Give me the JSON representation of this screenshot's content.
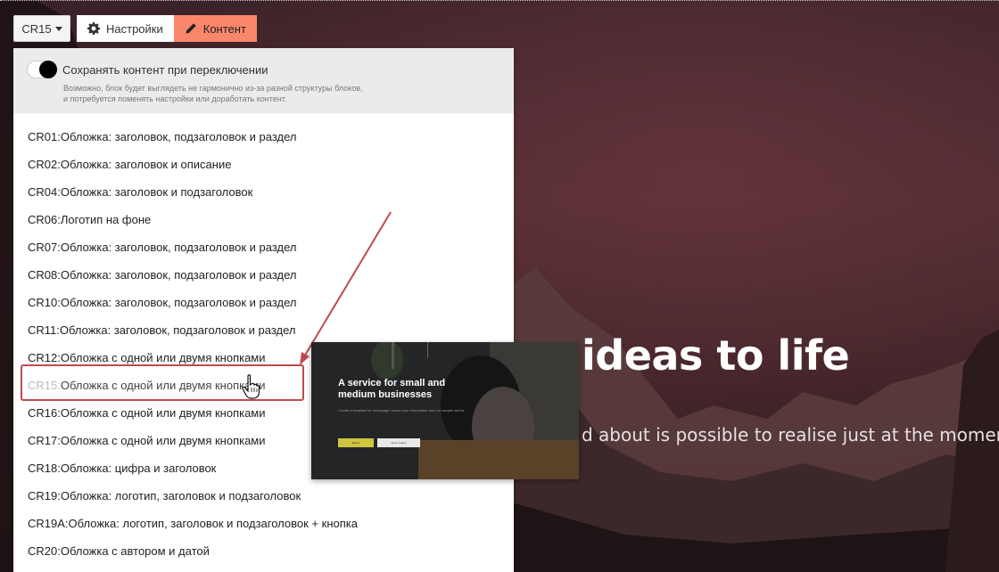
{
  "toolbar": {
    "block_code": "CR15",
    "settings_label": "Настройки",
    "content_label": "Контент",
    "active_tab": "content",
    "accent_color": "#fa876b"
  },
  "panel": {
    "keep_content_label": "Сохранять контент при переключении",
    "keep_content_on": true,
    "keep_content_note": "Возможно, блок будет выглядеть не гармонично из-за разной структуры блоков, и потребуется поменять настройки или доработать контент.",
    "items": [
      {
        "code": "CR01",
        "label": "Обложка: заголовок, подзаголовок и раздел"
      },
      {
        "code": "CR02",
        "label": "Обложка: заголовок и описание"
      },
      {
        "code": "CR04",
        "label": "Обложка: заголовок и подзаголовок"
      },
      {
        "code": "CR06",
        "label": "Логотип на фоне"
      },
      {
        "code": "CR07",
        "label": "Обложка: заголовок, подзаголовок и раздел"
      },
      {
        "code": "CR08",
        "label": "Обложка: заголовок, подзаголовок и раздел"
      },
      {
        "code": "CR10",
        "label": "Обложка: заголовок, подзаголовок и раздел"
      },
      {
        "code": "CR11",
        "label": "Обложка: заголовок, подзаголовок и раздел"
      },
      {
        "code": "CR12",
        "label": "Обложка с одной или двумя кнопками"
      },
      {
        "code": "CR15",
        "label": "Обложка с одной или двумя кнопками"
      },
      {
        "code": "CR16",
        "label": "Обложка с одной или двумя кнопками"
      },
      {
        "code": "CR17",
        "label": "Обложка с одной или двумя кнопками"
      },
      {
        "code": "CR18",
        "label": "Обложка: цифра и заголовок"
      },
      {
        "code": "CR19",
        "label": "Обложка: логотип, заголовок и подзаголовок"
      },
      {
        "code": "CR19A",
        "label": "Обложка: логотип, заголовок и подзаголовок + кнопка"
      },
      {
        "code": "CR20",
        "label": "Обложка с автором и датой"
      }
    ],
    "selected_code": "CR15",
    "highlight_color": "#c0494d"
  },
  "preview": {
    "title": "A service for small and medium businesses",
    "text": "Create a template for homepage. Leave your information and our sample will be",
    "button1": "Button",
    "button2": "Some button"
  },
  "hero": {
    "title": "ideas to life",
    "subtitle": "d about is possible to realise just at the moment"
  }
}
